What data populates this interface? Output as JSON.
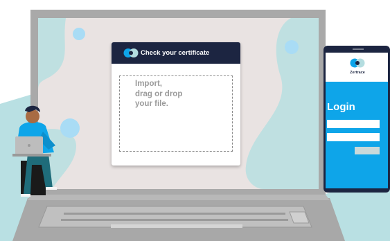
{
  "certificate": {
    "title": "Check your certificate",
    "drop_lines": [
      "Import,",
      "drag or drop",
      "your file."
    ]
  },
  "phone": {
    "brand": "Zertrace",
    "login_title": "Login"
  },
  "colors": {
    "navy": "#1c2541",
    "accent_blue": "#0ea5e9",
    "mint": "#b4dde0",
    "laptop_gray": "#a8a8a8",
    "screen_bg": "#e9e3e2"
  },
  "icons": [
    "zertrace-logo-icon",
    "laptop-illustration",
    "person-illustration"
  ]
}
